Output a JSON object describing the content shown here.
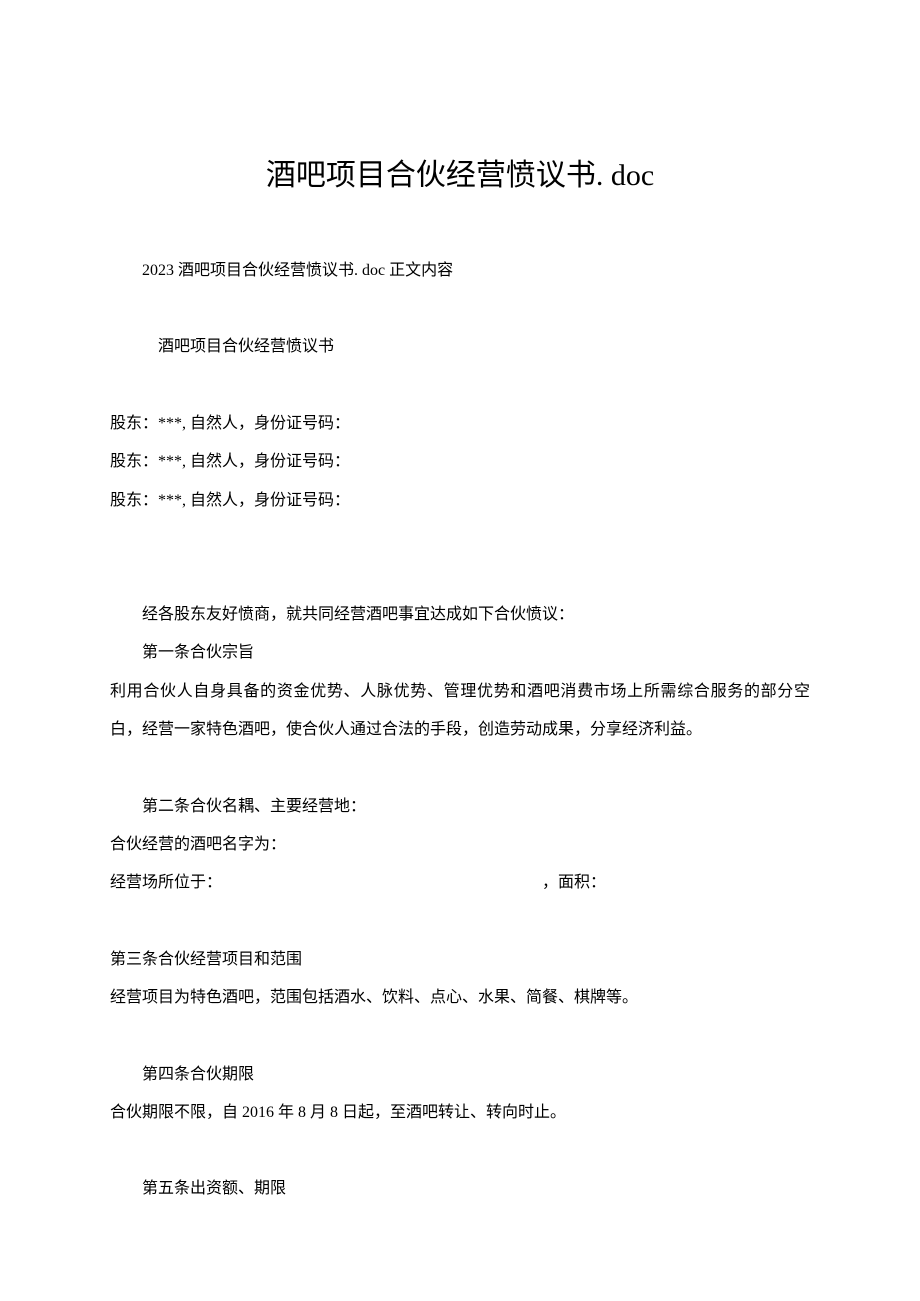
{
  "title": "酒吧项目合伙经营愤议书. doc",
  "intro": "2023 酒吧项目合伙经营愤议书. doc 正文内容",
  "subtitle": "酒吧项目合伙经营愤议书",
  "shareholders": {
    "line1": "股东：***, 自然人，身份证号码：",
    "line2": "股东：***, 自然人，身份证号码：",
    "line3": "股东：***, 自然人，身份证号码："
  },
  "preamble": "经各股东友好愤商，就共同经营酒吧事宜达成如下合伙愤议：",
  "article1": {
    "heading": "第一条合伙宗旨",
    "body": "利用合伙人自身具备的资金优势、人脉优势、管理优势和酒吧消费市场上所需综合服务的部分空白，经营一家特色酒吧，使合伙人通过合法的手段，创造劳动成果，分享经济利益。"
  },
  "article2": {
    "heading": "第二条合伙名耦、主要经营地：",
    "line1": "合伙经营的酒吧名字为：",
    "line2_left": "经营场所位于：",
    "line2_right": "，面积："
  },
  "article3": {
    "heading": "第三条合伙经营项目和范围",
    "body": "经营项目为特色酒吧，范围包括酒水、饮料、点心、水果、简餐、棋牌等。"
  },
  "article4": {
    "heading": "第四条合伙期限",
    "body": "合伙期限不限，自 2016 年 8 月 8 日起，至酒吧转让、转向时止。"
  },
  "article5": {
    "heading": "第五条出资额、期限"
  }
}
